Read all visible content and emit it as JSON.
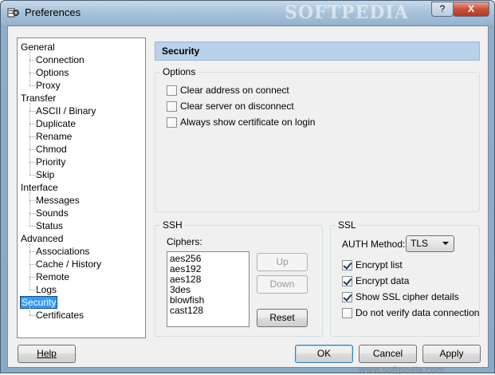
{
  "window": {
    "title": "Preferences",
    "help_label": "?",
    "close_label": "X",
    "watermark": "SOFTPEDIA"
  },
  "tree": {
    "items": [
      {
        "label": "General",
        "level": 0
      },
      {
        "label": "Connection",
        "level": 1
      },
      {
        "label": "Options",
        "level": 1
      },
      {
        "label": "Proxy",
        "level": 1
      },
      {
        "label": "Transfer",
        "level": 0
      },
      {
        "label": "ASCII / Binary",
        "level": 1
      },
      {
        "label": "Duplicate",
        "level": 1
      },
      {
        "label": "Rename",
        "level": 1
      },
      {
        "label": "Chmod",
        "level": 1
      },
      {
        "label": "Priority",
        "level": 1
      },
      {
        "label": "Skip",
        "level": 1
      },
      {
        "label": "Interface",
        "level": 0
      },
      {
        "label": "Messages",
        "level": 1
      },
      {
        "label": "Sounds",
        "level": 1
      },
      {
        "label": "Status",
        "level": 1
      },
      {
        "label": "Advanced",
        "level": 0
      },
      {
        "label": "Associations",
        "level": 1
      },
      {
        "label": "Cache / History",
        "level": 1
      },
      {
        "label": "Remote",
        "level": 1
      },
      {
        "label": "Logs",
        "level": 1
      },
      {
        "label": "Security",
        "level": 0,
        "selected": true
      },
      {
        "label": "Certificates",
        "level": 1
      }
    ]
  },
  "header": {
    "title": "Security"
  },
  "options": {
    "group_title": "Options",
    "items": [
      {
        "label": "Clear address on connect",
        "checked": false
      },
      {
        "label": "Clear server on disconnect",
        "checked": false
      },
      {
        "label": "Always show certificate on login",
        "checked": false
      }
    ]
  },
  "ssh": {
    "group_title": "SSH",
    "ciphers_label": "Ciphers:",
    "ciphers": [
      "aes256",
      "aes192",
      "aes128",
      "3des",
      "blowfish",
      "cast128"
    ],
    "up_label": "Up",
    "down_label": "Down",
    "reset_label": "Reset"
  },
  "ssl": {
    "group_title": "SSL",
    "auth_label": "AUTH Method:",
    "auth_value": "TLS",
    "items": [
      {
        "label": "Encrypt list",
        "checked": true
      },
      {
        "label": "Encrypt data",
        "checked": true
      },
      {
        "label": "Show SSL cipher details",
        "checked": true
      },
      {
        "label": "Do not verify data connection",
        "checked": false
      }
    ]
  },
  "footer": {
    "help_label": "Help",
    "ok_label": "OK",
    "cancel_label": "Cancel",
    "apply_label": "Apply",
    "watermark": "www.softpedia.com"
  }
}
